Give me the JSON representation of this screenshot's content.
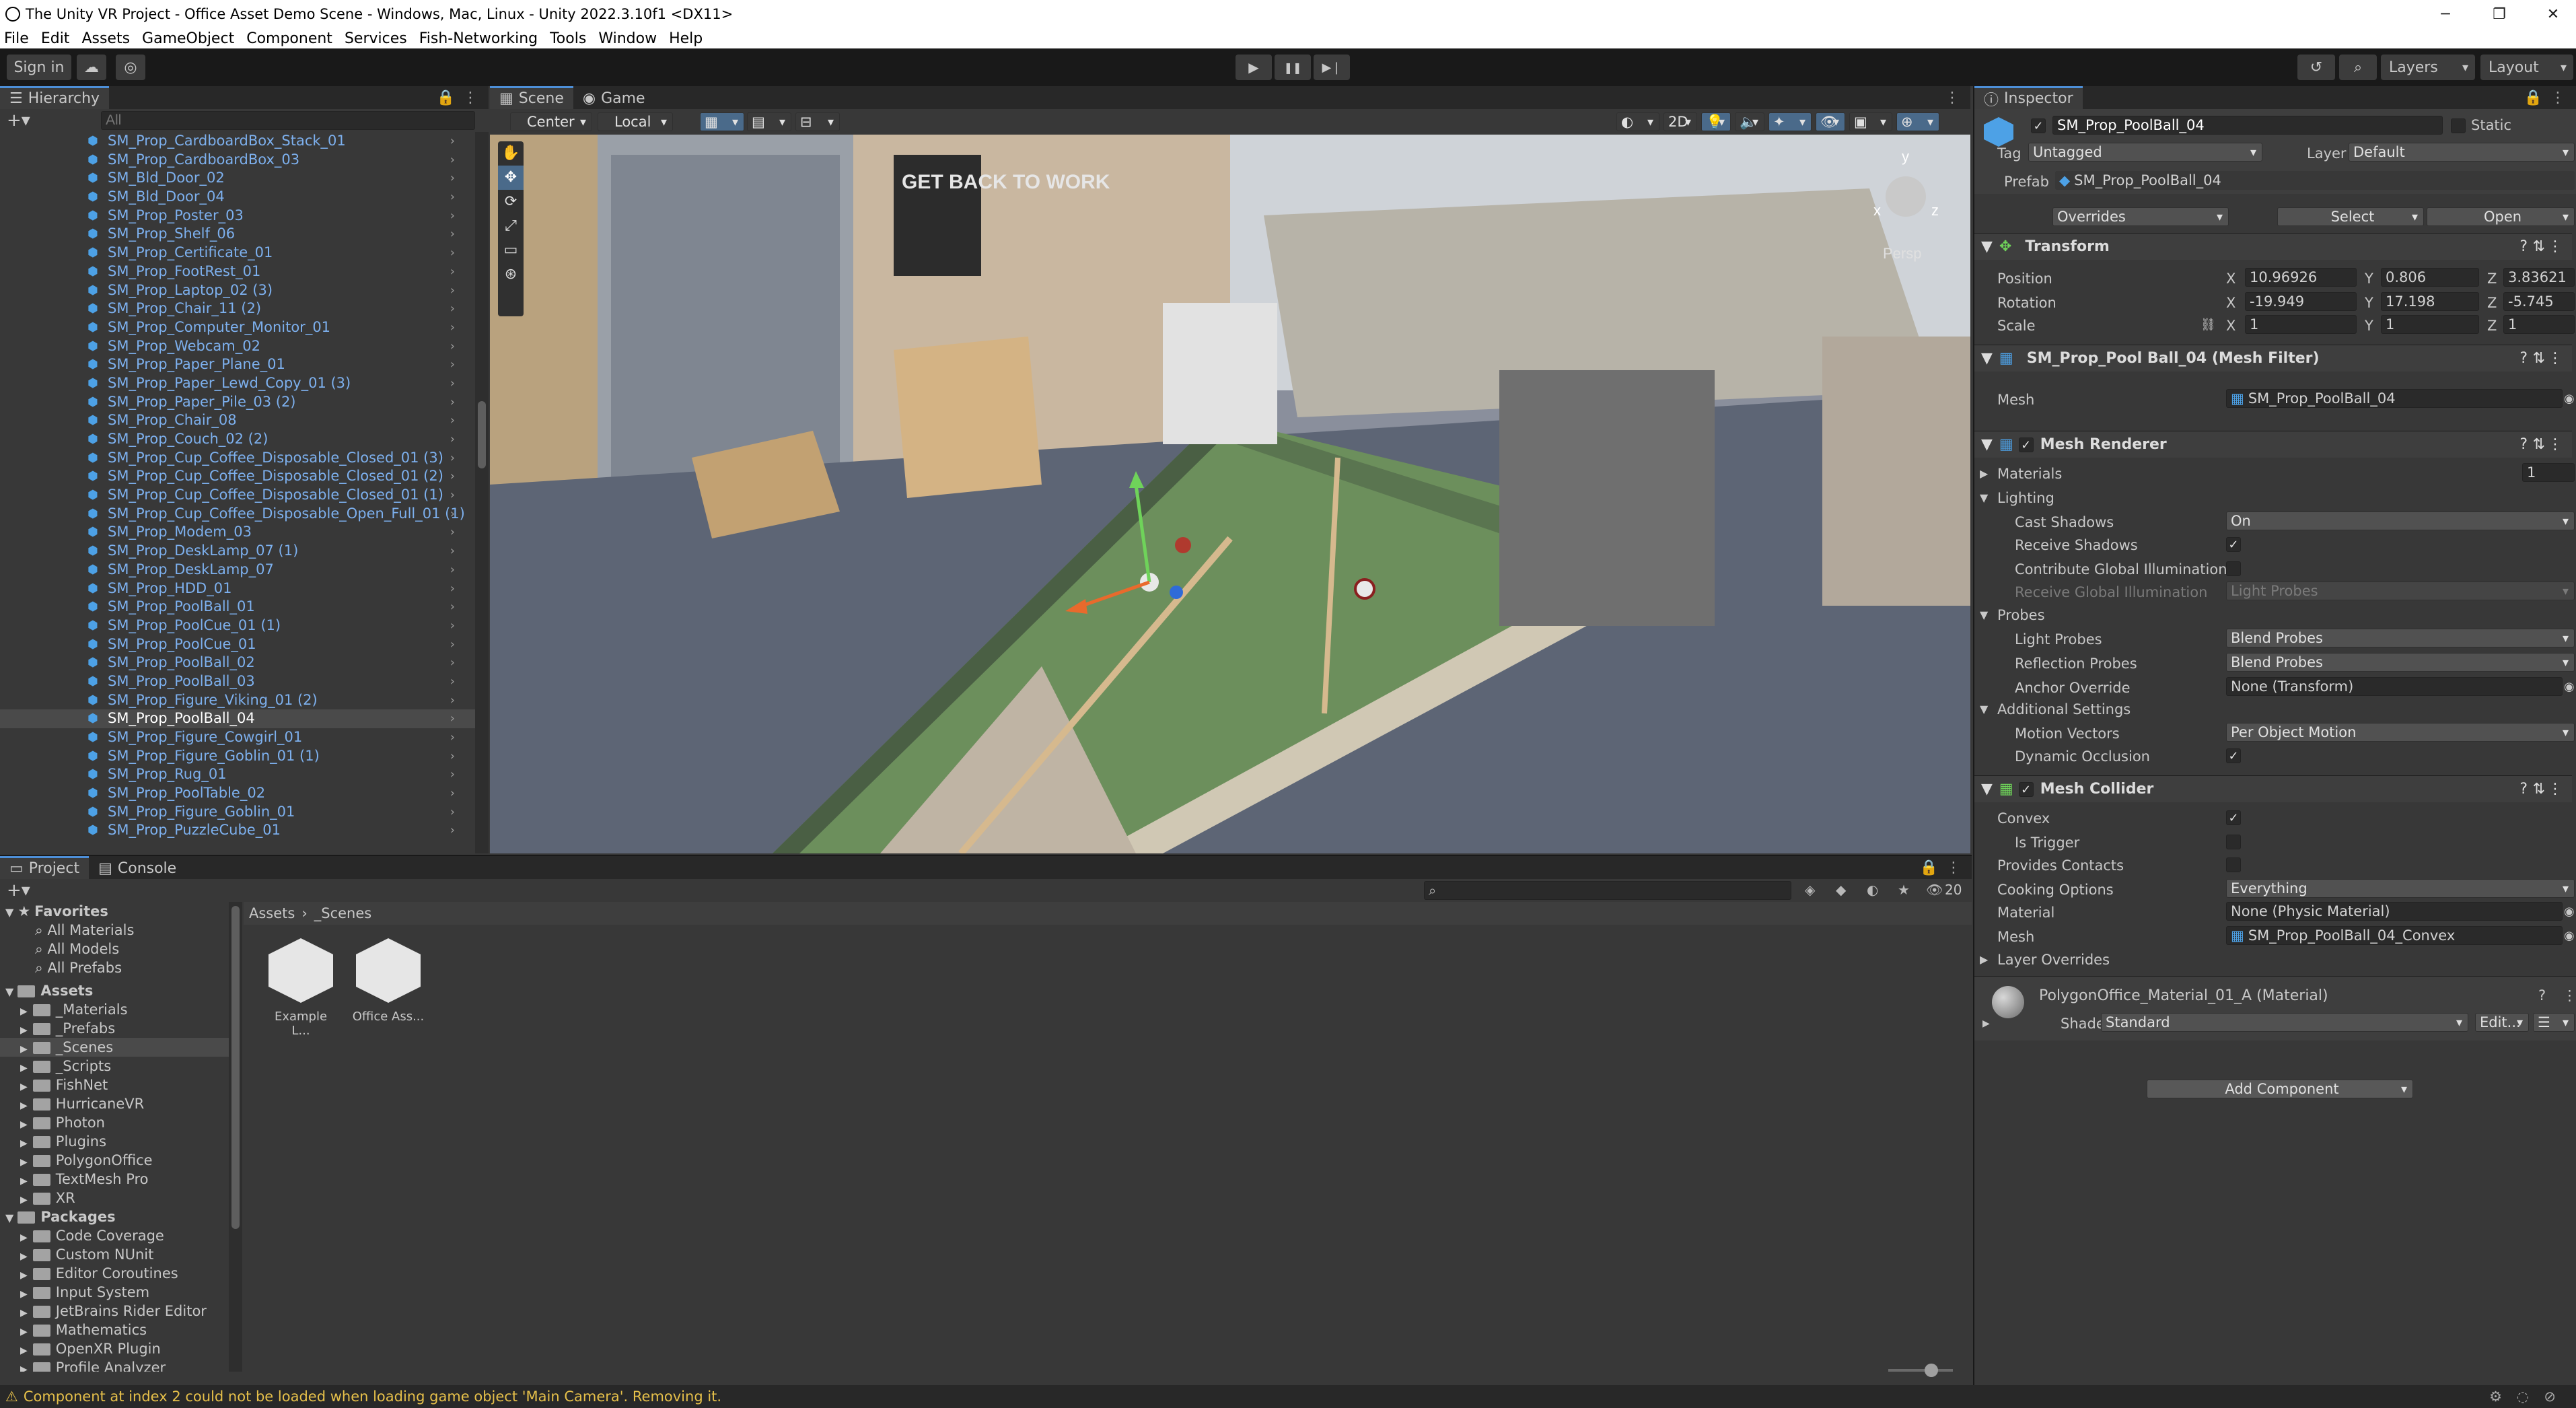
{
  "window": {
    "title": "The Unity VR Project - Office Asset Demo Scene - Windows, Mac, Linux - Unity 2022.3.10f1 <DX11>",
    "minimize": "─",
    "maximize": "❐",
    "close": "✕"
  },
  "menu": [
    "File",
    "Edit",
    "Assets",
    "GameObject",
    "Component",
    "Services",
    "Fish-Networking",
    "Tools",
    "Window",
    "Help"
  ],
  "toolbar": {
    "sign_in": "Sign in",
    "play": "▶",
    "pause": "❚❚",
    "step": "▶❘",
    "layers": "Layers",
    "layout": "Layout"
  },
  "hierarchy": {
    "tab": "Hierarchy",
    "search_placeholder": "All",
    "items": [
      "SM_Prop_CardboardBox_Stack_01",
      "SM_Prop_CardboardBox_03",
      "SM_Bld_Door_02",
      "SM_Bld_Door_04",
      "SM_Prop_Poster_03",
      "SM_Prop_Shelf_06",
      "SM_Prop_Certificate_01",
      "SM_Prop_FootRest_01",
      "SM_Prop_Laptop_02 (3)",
      "SM_Prop_Chair_11 (2)",
      "SM_Prop_Computer_Monitor_01",
      "SM_Prop_Webcam_02",
      "SM_Prop_Paper_Plane_01",
      "SM_Prop_Paper_Lewd_Copy_01 (3)",
      "SM_Prop_Paper_Pile_03 (2)",
      "SM_Prop_Chair_08",
      "SM_Prop_Couch_02 (2)",
      "SM_Prop_Cup_Coffee_Disposable_Closed_01 (3)",
      "SM_Prop_Cup_Coffee_Disposable_Closed_01 (2)",
      "SM_Prop_Cup_Coffee_Disposable_Closed_01 (1)",
      "SM_Prop_Cup_Coffee_Disposable_Open_Full_01 (1)",
      "SM_Prop_Modem_03",
      "SM_Prop_DeskLamp_07 (1)",
      "SM_Prop_DeskLamp_07",
      "SM_Prop_HDD_01",
      "SM_Prop_PoolBall_01",
      "SM_Prop_PoolCue_01 (1)",
      "SM_Prop_PoolCue_01",
      "SM_Prop_PoolBall_02",
      "SM_Prop_PoolBall_03",
      "SM_Prop_Figure_Viking_01 (2)",
      "SM_Prop_PoolBall_04",
      "SM_Prop_Figure_Cowgirl_01",
      "SM_Prop_Figure_Goblin_01 (1)",
      "SM_Prop_Rug_01",
      "SM_Prop_PoolTable_02",
      "SM_Prop_Figure_Goblin_01",
      "SM_Prop_PuzzleCube_01"
    ],
    "selected_index": 31
  },
  "scene": {
    "tabs": [
      "Scene",
      "Game"
    ],
    "pivot": "Center",
    "space": "Local",
    "mode_2d": "2D",
    "persp": "Persp",
    "gizmo_y": "y",
    "gizmo_x": "x",
    "gizmo_z": "z",
    "poster": "GET BACK TO WORK"
  },
  "inspector": {
    "tab": "Inspector",
    "object_name": "SM_Prop_PoolBall_04",
    "static_label": "Static",
    "tag_label": "Tag",
    "tag_value": "Untagged",
    "layer_label": "Layer",
    "layer_value": "Default",
    "prefab_label": "Prefab",
    "prefab_value": "SM_Prop_PoolBall_04",
    "overrides": "Overrides",
    "select": "Select",
    "open": "Open",
    "transform": {
      "title": "Transform",
      "position_label": "Position",
      "rotation_label": "Rotation",
      "scale_label": "Scale",
      "position": {
        "x": "10.96926",
        "y": "0.806",
        "z": "3.83621"
      },
      "rotation": {
        "x": "-19.949",
        "y": "17.198",
        "z": "-5.745"
      },
      "scale": {
        "x": "1",
        "y": "1",
        "z": "1"
      }
    },
    "mesh_filter": {
      "title": "SM_Prop_Pool Ball_04 (Mesh Filter)",
      "mesh_label": "Mesh",
      "mesh_value": "SM_Prop_PoolBall_04"
    },
    "mesh_renderer": {
      "title": "Mesh Renderer",
      "materials_label": "Materials",
      "materials_count": "1",
      "lighting_label": "Lighting",
      "cast_shadows_label": "Cast Shadows",
      "cast_shadows_value": "On",
      "receive_shadows_label": "Receive Shadows",
      "contribute_gi_label": "Contribute Global Illumination",
      "receive_gi_label": "Receive Global Illumination",
      "receive_gi_value": "Light Probes",
      "probes_label": "Probes",
      "light_probes_label": "Light Probes",
      "light_probes_value": "Blend Probes",
      "reflection_probes_label": "Reflection Probes",
      "reflection_probes_value": "Blend Probes",
      "anchor_override_label": "Anchor Override",
      "anchor_override_value": "None (Transform)",
      "additional_settings_label": "Additional Settings",
      "motion_vectors_label": "Motion Vectors",
      "motion_vectors_value": "Per Object Motion",
      "dynamic_occlusion_label": "Dynamic Occlusion"
    },
    "mesh_collider": {
      "title": "Mesh Collider",
      "convex_label": "Convex",
      "is_trigger_label": "Is Trigger",
      "provides_contacts_label": "Provides Contacts",
      "cooking_options_label": "Cooking Options",
      "cooking_options_value": "Everything",
      "material_label": "Material",
      "material_value": "None (Physic Material)",
      "mesh_label": "Mesh",
      "mesh_value": "SM_Prop_PoolBall_04_Convex",
      "layer_overrides_label": "Layer Overrides"
    },
    "material": {
      "title": "PolygonOffice_Material_01_A (Material)",
      "shader_label": "Shader",
      "shader_value": "Standard",
      "edit": "Edit..."
    },
    "add_component": "Add Component"
  },
  "project": {
    "tabs": [
      "Project",
      "Console"
    ],
    "favorites_label": "Favorites",
    "favorites": [
      "All Materials",
      "All Models",
      "All Prefabs"
    ],
    "assets_label": "Assets",
    "asset_folders": [
      "_Materials",
      "_Prefabs",
      "_Scenes",
      "_Scripts",
      "FishNet",
      "HurricaneVR",
      "Photon",
      "Plugins",
      "PolygonOffice",
      "TextMesh Pro",
      "XR"
    ],
    "selected_folder": "_Scenes",
    "packages_label": "Packages",
    "packages": [
      "Code Coverage",
      "Custom NUnit",
      "Editor Coroutines",
      "Input System",
      "JetBrains Rider Editor",
      "Mathematics",
      "OpenXR Plugin",
      "Profile Analyzer"
    ],
    "breadcrumb": [
      "Assets",
      "_Scenes"
    ],
    "files": [
      "Example L...",
      "Office Ass..."
    ],
    "hidden_count": "20"
  },
  "status": {
    "message": "Component at index 2 could not be loaded when loading game object 'Main Camera'. Removing it."
  }
}
